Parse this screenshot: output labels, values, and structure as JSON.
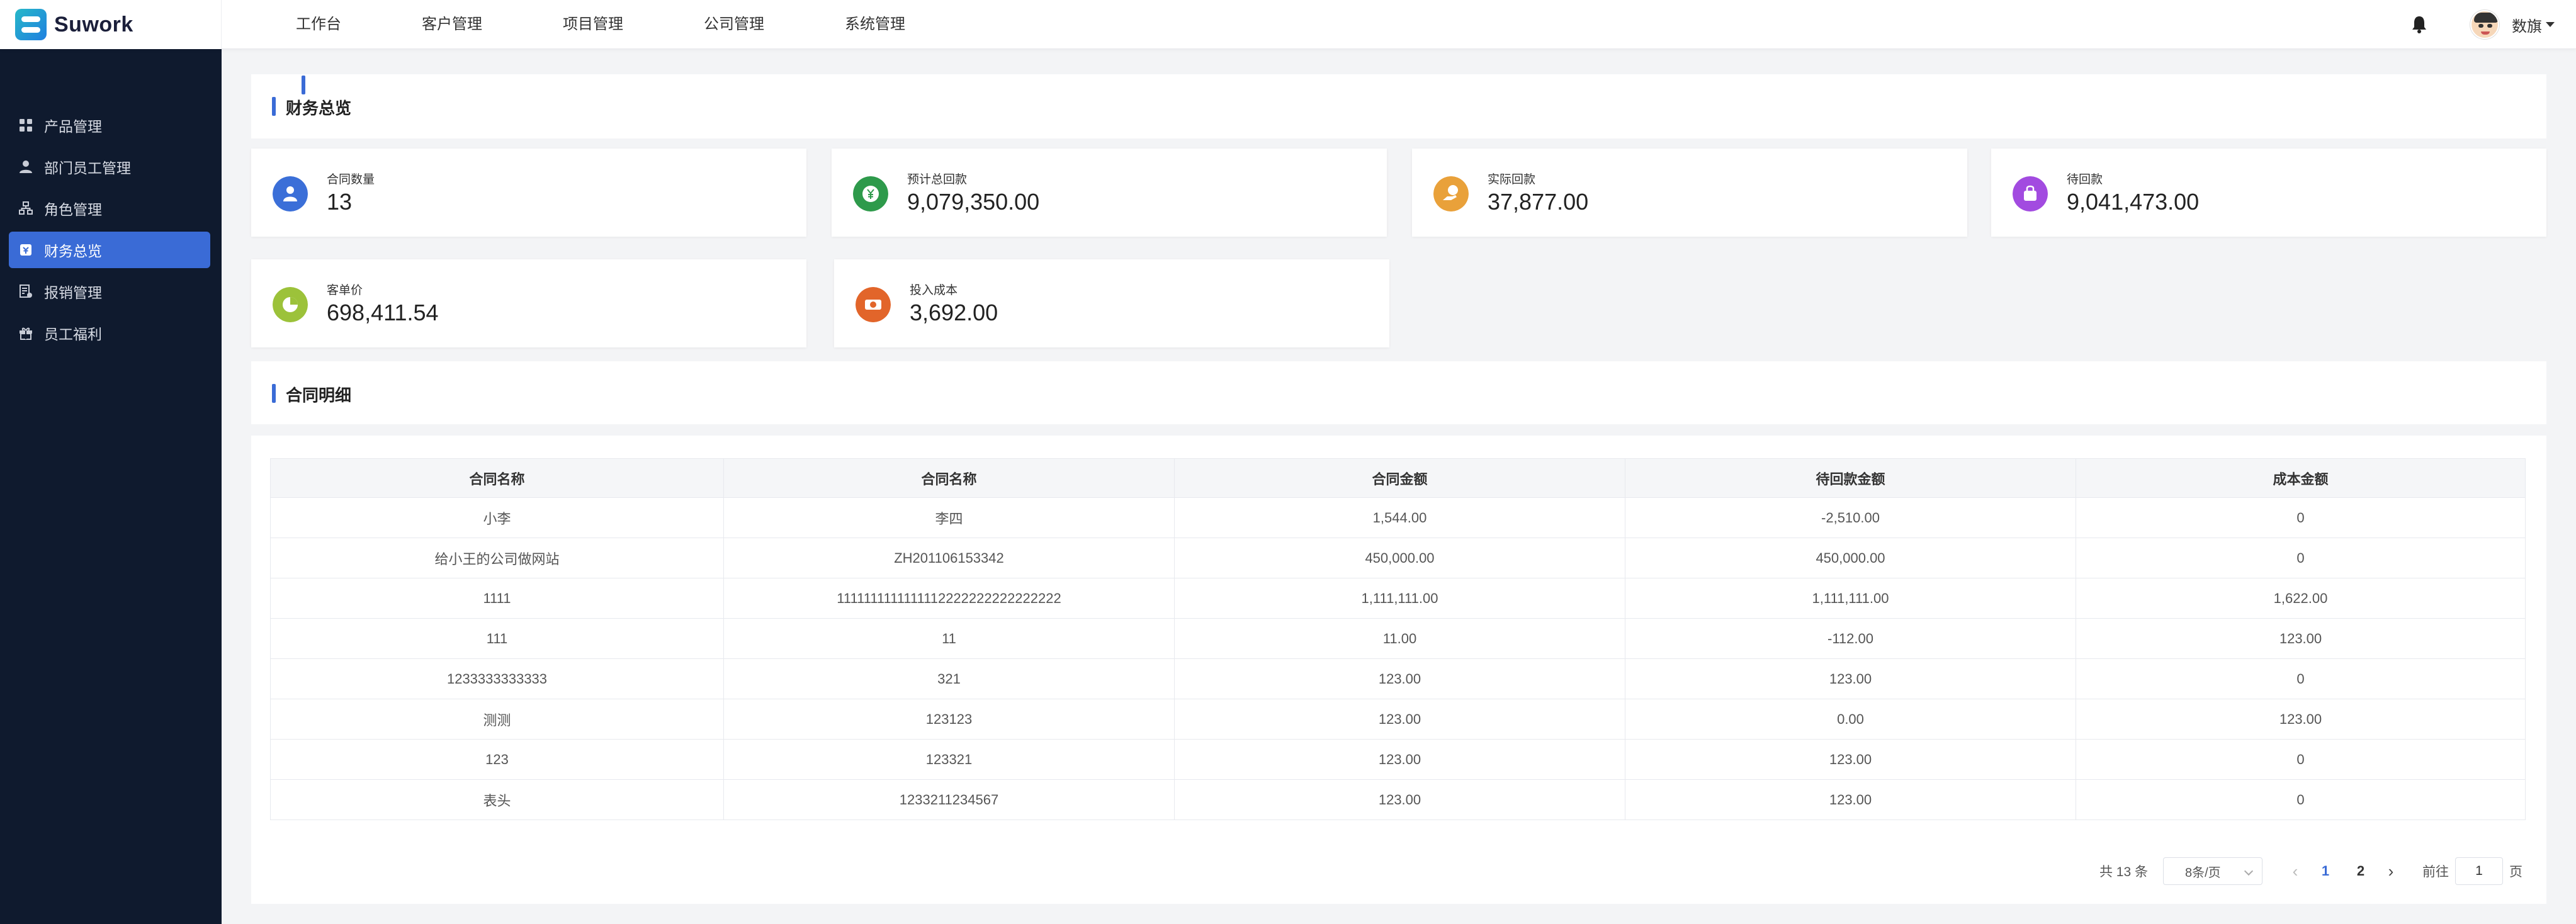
{
  "app": {
    "logo_text": "Suwork"
  },
  "topnav": [
    "工作台",
    "客户管理",
    "项目管理",
    "公司管理",
    "系统管理"
  ],
  "user": {
    "name": "数旗"
  },
  "sidebar": {
    "items": [
      {
        "label": "产品管理",
        "icon": "grid-icon"
      },
      {
        "label": "部门员工管理",
        "icon": "user-icon"
      },
      {
        "label": "角色管理",
        "icon": "org-chart-icon"
      },
      {
        "label": "财务总览",
        "icon": "finance-icon",
        "active": true
      },
      {
        "label": "报销管理",
        "icon": "document-icon"
      },
      {
        "label": "员工福利",
        "icon": "gift-icon"
      }
    ]
  },
  "overview": {
    "title": "财务总览",
    "cards": [
      {
        "label": "合同数量",
        "value": "13",
        "color": "#3b6fd8",
        "icon": "person-icon"
      },
      {
        "label": "预计总回款",
        "value": "9,079,350.00",
        "color": "#2e9a4b",
        "icon": "yen-icon"
      },
      {
        "label": "实际回款",
        "value": "37,877.00",
        "color": "#e9a13a",
        "icon": "payment-hand-icon"
      },
      {
        "label": "待回款",
        "value": "9,041,473.00",
        "color": "#a24be0",
        "icon": "bag-icon"
      },
      {
        "label": "客单价",
        "value": "698,411.54",
        "color": "#9cc23a",
        "icon": "pie-icon"
      },
      {
        "label": "投入成本",
        "value": "3,692.00",
        "color": "#e2652a",
        "icon": "money-icon"
      }
    ]
  },
  "detail": {
    "title": "合同明细",
    "columns": [
      "合同名称",
      "合同名称",
      "合同金额",
      "待回款金额",
      "成本金额"
    ],
    "rows": [
      [
        "小李",
        "李四",
        "1,544.00",
        "-2,510.00",
        "0"
      ],
      [
        "给小王的公司做网站",
        "ZH201106153342",
        "450,000.00",
        "450,000.00",
        "0"
      ],
      [
        "1111",
        "1111111111111112222222222222222",
        "1,111,111.00",
        "1,111,111.00",
        "1,622.00"
      ],
      [
        "111",
        "11",
        "11.00",
        "-112.00",
        "123.00"
      ],
      [
        "1233333333333",
        "321",
        "123.00",
        "123.00",
        "0"
      ],
      [
        "测测",
        "123123",
        "123.00",
        "0.00",
        "123.00"
      ],
      [
        "123",
        "123321",
        "123.00",
        "123.00",
        "0"
      ],
      [
        "表头",
        "1233211234567",
        "123.00",
        "123.00",
        "0"
      ]
    ]
  },
  "pagination": {
    "total_text": "共 13 条",
    "page_size": "8条/页",
    "pages": [
      "1",
      "2"
    ],
    "current_page": "1",
    "goto_label": "前往",
    "goto_value": "1",
    "page_suffix": "页"
  }
}
